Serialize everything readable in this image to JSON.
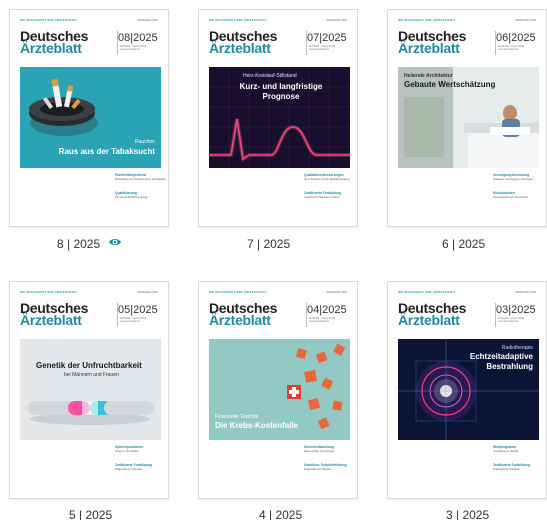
{
  "brand": {
    "tagline": "DIE ZEITSCHRIFT DER ÄRZTESCHAFT",
    "line1": "Deutsches",
    "line2": "Ärzteblatt",
    "publisher": "JAHRGANG 2025"
  },
  "colors": {
    "accent": "#1d8ba3",
    "hero_8": "#2aa3b4",
    "hero_7": "#1a0e2e",
    "hero_5": "#e9ecee",
    "hero_4": "#8fc7c2",
    "hero_3": "#0a1232"
  },
  "issues": [
    {
      "label": "8 | 2025",
      "cover_issue": "08|2025",
      "issue_sub": "Ärzteblatt · Neues Portal · www.aerzteblatt.de",
      "hero_small": "Rauchen",
      "hero_title": "Raus aus der Tabaksucht",
      "blocks": [
        {
          "title": "Fächerübergreifend",
          "text": "Behandlung von Kopfschmerzen und Migräne"
        },
        {
          "title": "Qualifizierung",
          "text": "Wie die Weiterbildung gelingt"
        }
      ],
      "viewed": true
    },
    {
      "label": "7 | 2025",
      "cover_issue": "07|2025",
      "issue_sub": "Ärzteblatt · Neues Portal · www.aerzteblatt.de",
      "hero_small": "Herz-Kreislauf-Stillstand",
      "hero_title": "Kurz- und langfristige Prognose",
      "blocks": [
        {
          "title": "Qualitätsverbesserungen",
          "text": "Neue Strukturen in der Notfallversorgung"
        },
        {
          "title": "Zertifizierte Fortbildung",
          "text": "Geriatrische Patienten im Fokus"
        }
      ],
      "viewed": false
    },
    {
      "label": "6 | 2025",
      "cover_issue": "06|2025",
      "issue_sub": "Ärzteblatt · Neues Portal · www.aerzteblatt.de",
      "hero_small": "Heilende Architektur",
      "hero_title": "Gebaute Wertschätzung",
      "blocks": [
        {
          "title": "Versorgungsforschung",
          "text": "Stationäre Versorgung in der Region"
        },
        {
          "title": "Klinikarbeiten",
          "text": "Personalplanung in der Zukunft"
        }
      ],
      "viewed": false
    },
    {
      "label": "5 | 2025",
      "cover_issue": "05|2025",
      "issue_sub": "Ärzteblatt · Neues Portal · www.aerzteblatt.de",
      "hero_small": "bei Männern und Frauen",
      "hero_title": "Genetik der Unfruchtbarkeit",
      "blocks": [
        {
          "title": "Spitzenpositionen",
          "text": "Frauen in der Medizin"
        },
        {
          "title": "Zertifizierte Fortbildung",
          "text": "Diagnostik und Therapie"
        }
      ],
      "viewed": false
    },
    {
      "label": "4 | 2025",
      "cover_issue": "04|2025",
      "issue_sub": "Ärzteblatt · Neues Portal · www.aerzteblatt.de",
      "hero_small": "Finanzielle Toxizität",
      "hero_title": "Die Krebs-Kostenfalle",
      "blocks": [
        {
          "title": "Kindesentwicklung",
          "text": "Neue Leitlinie zur Vorsorge"
        },
        {
          "title": "Gedeihen: Schulleitbildung",
          "text": "Diagnostik und Therapie"
        }
      ],
      "viewed": false
    },
    {
      "label": "3 | 2025",
      "cover_issue": "03|2025",
      "issue_sub": "Ärzteblatt · Neues Portal · www.aerzteblatt.de",
      "hero_small": "Radiotherapie",
      "hero_title_1": "Echtzeitadaptive",
      "hero_title_2": "Bestrahlung",
      "blocks": [
        {
          "title": "Weltprogramm",
          "text": "Versorgung im Wandel"
        },
        {
          "title": "Zertifizierte Fortbildung",
          "text": "Onkologische Therapien"
        }
      ],
      "viewed": false
    }
  ]
}
